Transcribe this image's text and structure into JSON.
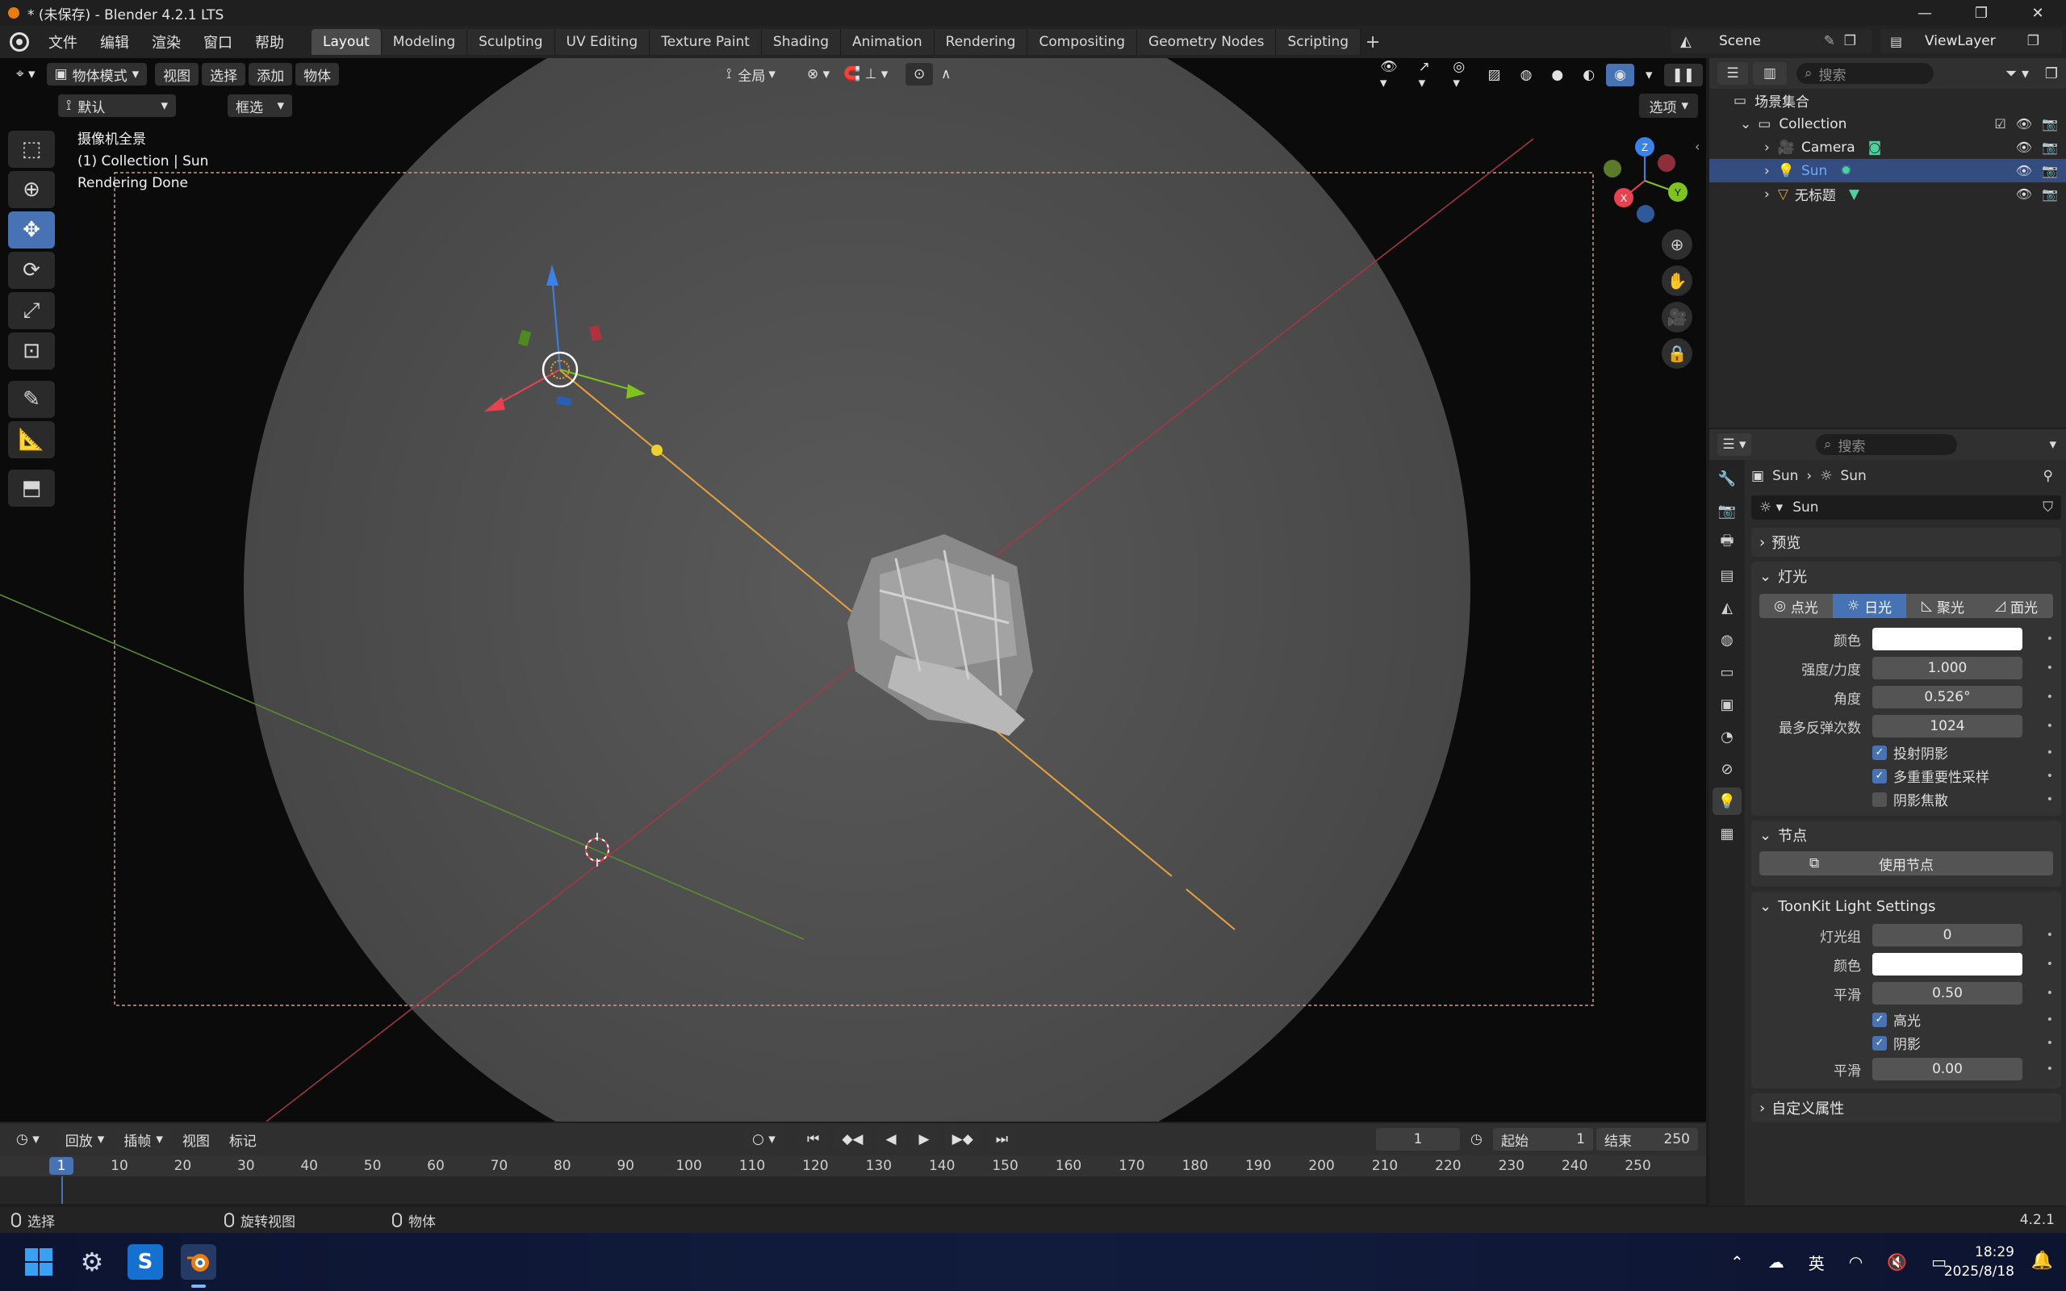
{
  "window": {
    "title": "* (未保存) - Blender 4.2.1 LTS",
    "controls": [
      "—",
      "❐",
      "✕"
    ]
  },
  "menus": [
    "文件",
    "编辑",
    "渲染",
    "窗口",
    "帮助"
  ],
  "workspaces": [
    "Layout",
    "Modeling",
    "Sculpting",
    "UV Editing",
    "Texture Paint",
    "Shading",
    "Animation",
    "Rendering",
    "Compositing",
    "Geometry Nodes",
    "Scripting"
  ],
  "active_workspace": "Layout",
  "scene": "Scene",
  "view_layer": "ViewLayer",
  "viewport": {
    "mode": "物体模式",
    "menus": [
      "视图",
      "选择",
      "添加",
      "物体"
    ],
    "orientation": "默认",
    "select_mode": "框选",
    "transform": "全局",
    "options": "选项",
    "overlay": {
      "view_name": "摄像机全景",
      "collection_info": "(1) Collection | Sun",
      "status": "Rendering Done"
    },
    "gizmo": {
      "x": "X",
      "y": "Y",
      "z": "Z"
    }
  },
  "outliner": {
    "search_placeholder": "搜索",
    "root": "场景集合",
    "collection": "Collection",
    "items": [
      {
        "name": "Camera",
        "icon": "camera-icon",
        "selected": false
      },
      {
        "name": "Sun",
        "icon": "light-icon",
        "selected": true
      },
      {
        "name": "无标题",
        "icon": "mesh-icon",
        "selected": false
      }
    ]
  },
  "properties": {
    "search_placeholder": "搜索",
    "breadcrumb": [
      "Sun",
      "Sun"
    ],
    "datablock": "Sun",
    "panels": {
      "preview": "预览",
      "light": "灯光",
      "nodes": "节点",
      "toonkit": "ToonKit Light Settings",
      "custom": "自定义属性"
    },
    "light_types": [
      "点光",
      "日光",
      "聚光",
      "面光"
    ],
    "active_light_type": "日光",
    "light_props": [
      {
        "label": "颜色",
        "value": "",
        "type": "color"
      },
      {
        "label": "强度/力度",
        "value": "1.000"
      },
      {
        "label": "角度",
        "value": "0.526°"
      },
      {
        "label": "最多反弹次数",
        "value": "1024"
      }
    ],
    "light_checks": [
      {
        "label": "投射阴影",
        "checked": true
      },
      {
        "label": "多重重要性采样",
        "checked": true
      },
      {
        "label": "阴影焦散",
        "checked": false
      }
    ],
    "use_nodes": "使用节点",
    "toonkit_props": {
      "light_group_label": "灯光组",
      "light_group": "0",
      "color_label": "颜色",
      "smooth_label": "平滑",
      "smooth": "0.50",
      "highlight_label": "高光",
      "shadow_label": "阴影",
      "smooth2_label": "平滑",
      "smooth2": "0.00"
    }
  },
  "timeline": {
    "menus": [
      "回放",
      "插帧",
      "视图",
      "标记"
    ],
    "current_frame": "1",
    "start_label": "起始",
    "start": "1",
    "end_label": "结束",
    "end": "250",
    "ruler": [
      "1",
      "10",
      "20",
      "30",
      "40",
      "50",
      "60",
      "70",
      "80",
      "90",
      "100",
      "110",
      "120",
      "130",
      "140",
      "150",
      "160",
      "170",
      "180",
      "190",
      "200",
      "210",
      "220",
      "230",
      "240",
      "250"
    ]
  },
  "statusbar": {
    "select": "选择",
    "rotate": "旋转视图",
    "object": "物体",
    "version": "4.2.1"
  },
  "taskbar": {
    "ime": "英",
    "time": "18:29",
    "date": "2025/8/18"
  },
  "colors": {
    "accent": "#4772b3",
    "selection": "#334d80",
    "sun_line": "#e8a33d",
    "x_axis": "#e8414f",
    "y_axis": "#7fc41e",
    "z_axis": "#3b82e8"
  }
}
